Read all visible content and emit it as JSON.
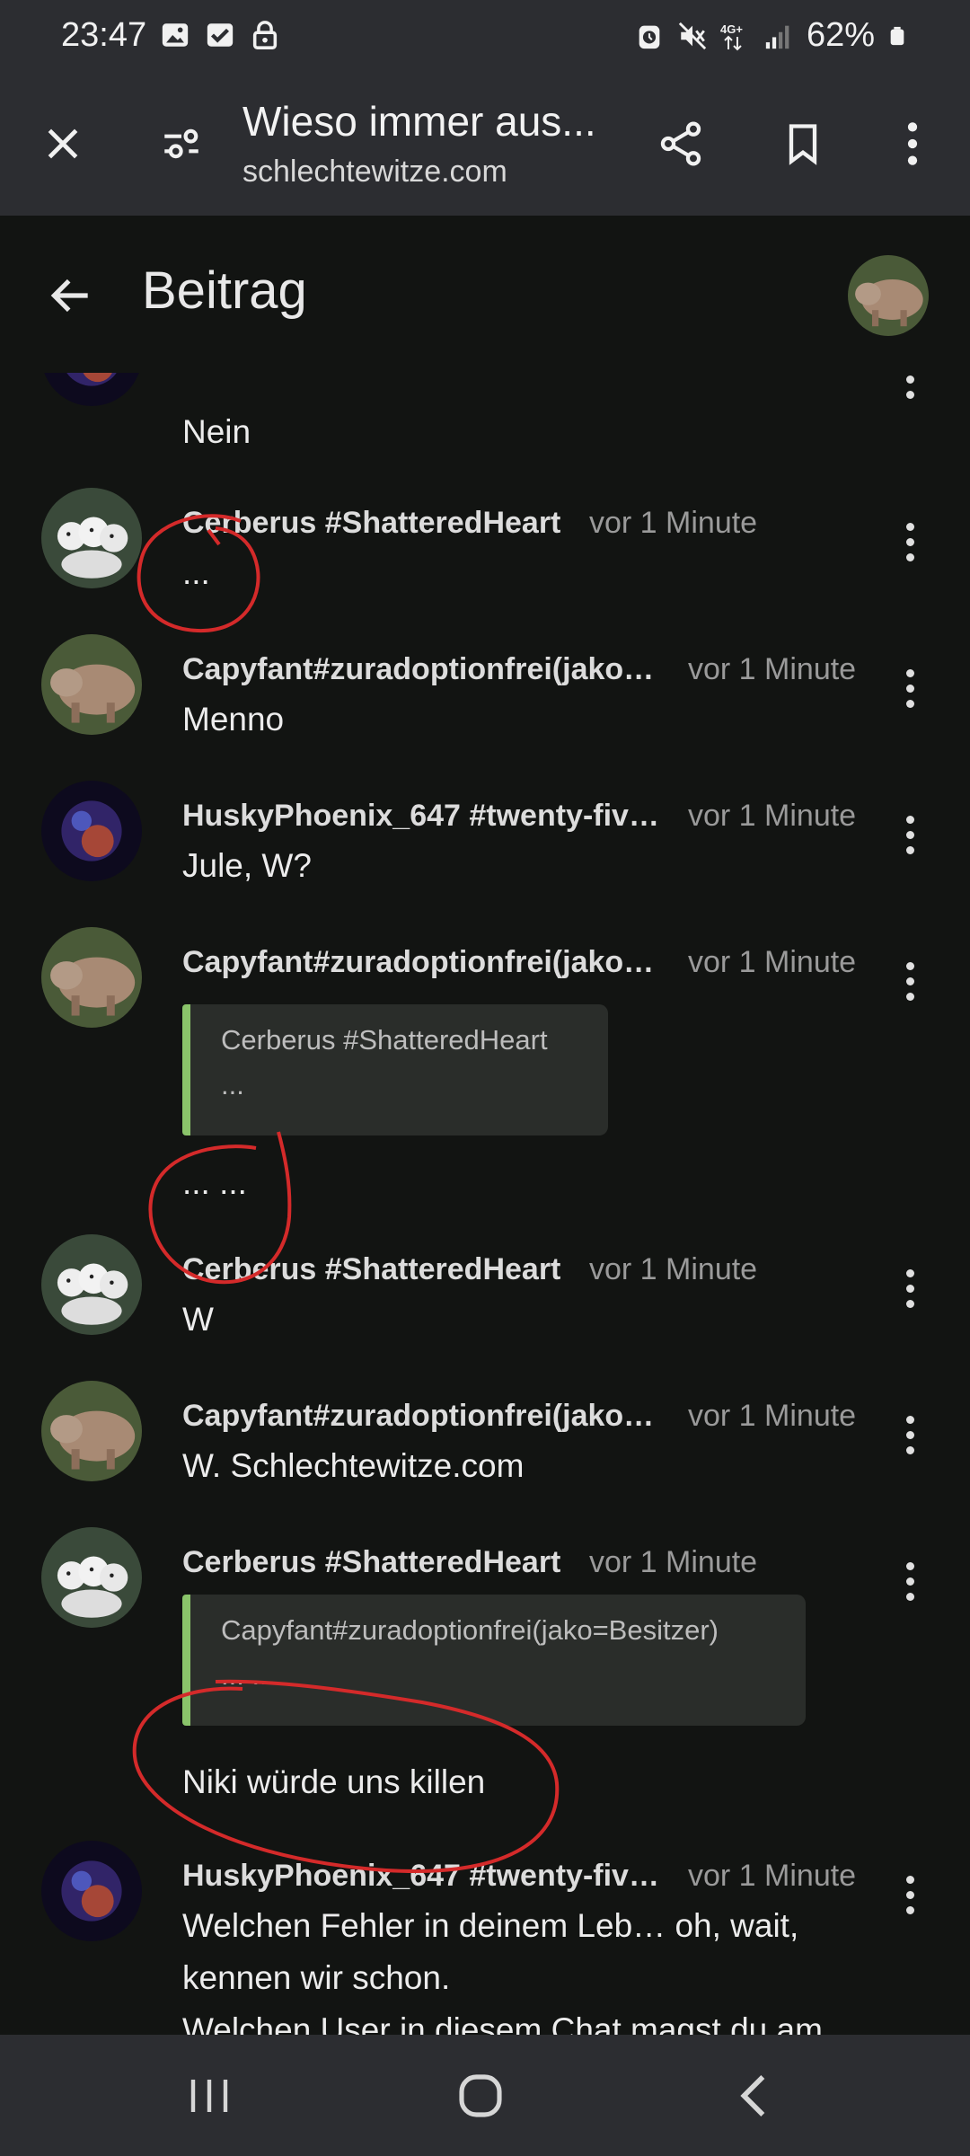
{
  "status_bar": {
    "time": "23:47",
    "battery": "62%",
    "network": "4G+",
    "left_icons": [
      "image-icon",
      "check-box-icon",
      "lock-icon"
    ],
    "right_icons": [
      "alarm-icon",
      "mute-icon",
      "network-4g-icon",
      "signal-icon",
      "battery-icon"
    ]
  },
  "browser": {
    "title": "Wieso immer aus...",
    "url": "schlechtewitze.com"
  },
  "page": {
    "title": "Beitrag"
  },
  "messages": [
    {
      "author": "",
      "time": "",
      "text": "Nein",
      "avatar": "nebula"
    },
    {
      "author": "Cerberus #ShatteredHeart",
      "time": "vor 1 Minute",
      "text": "...",
      "avatar": "puppies"
    },
    {
      "author": "Capyfant#zuradoptionfrei(jako…",
      "time": "vor 1 Minute",
      "text": "Menno",
      "avatar": "capyfant"
    },
    {
      "author": "HuskyPhoenix_647 #twenty-fiv…",
      "time": "vor 1 Minute",
      "text": "Jule, W?",
      "avatar": "nebula"
    },
    {
      "author": "Capyfant#zuradoptionfrei(jako…",
      "time": "vor 1 Minute",
      "quote_author": "Cerberus #ShatteredHeart",
      "quote_text": "...",
      "text": "... ...",
      "avatar": "capyfant"
    },
    {
      "author": "Cerberus #ShatteredHeart",
      "time": "vor 1 Minute",
      "text": "W",
      "avatar": "puppies"
    },
    {
      "author": "Capyfant#zuradoptionfrei(jako…",
      "time": "vor 1 Minute",
      "text": "W. Schlechtewitze.com",
      "avatar": "capyfant"
    },
    {
      "author": "Cerberus #ShatteredHeart",
      "time": "vor 1 Minute",
      "quote_author": "Capyfant#zuradoptionfrei(jako=Besitzer)",
      "quote_text": "... ...",
      "text": "Niki würde uns killen",
      "avatar": "puppies"
    },
    {
      "author": "HuskyPhoenix_647 #twenty-fiv…",
      "time": "vor 1 Minute",
      "text_lines": [
        "Welchen Fehler in deinem Leb… oh, wait,",
        "kennen wir schon.",
        "Welchen User in diesem Chat magst du am"
      ],
      "avatar": "nebula"
    }
  ],
  "colors": {
    "background": "#121412",
    "toolbar": "#2c2d31",
    "quote_accent": "#8ac46a",
    "annotation": "#d42a2a"
  }
}
